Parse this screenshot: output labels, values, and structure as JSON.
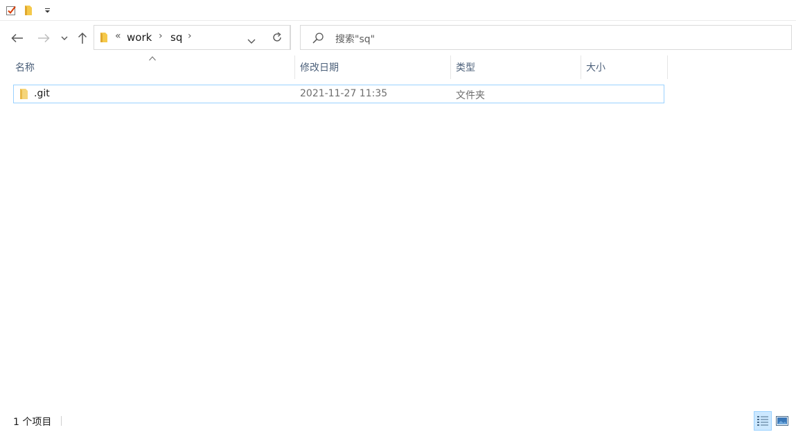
{
  "qat": {
    "icons": [
      "properties-checkmark-icon",
      "folder-icon",
      "customize-dropdown-icon"
    ]
  },
  "nav": {
    "back_icon": "back-arrow-icon",
    "forward_icon": "forward-arrow-icon",
    "recent_icon": "recent-locations-chevron-icon",
    "up_icon": "up-arrow-icon",
    "refresh_icon": "refresh-icon"
  },
  "address": {
    "overflow": "«",
    "crumbs": [
      "work",
      "sq"
    ],
    "separator": "›"
  },
  "search": {
    "placeholder": "搜索\"sq\""
  },
  "columns": {
    "name": "名称",
    "date": "修改日期",
    "type": "类型",
    "size": "大小",
    "sorted_by": "name"
  },
  "rows": [
    {
      "name": ".git",
      "date": "2021-11-27 11:35",
      "type": "文件夹",
      "size": ""
    }
  ],
  "status": {
    "count": "1 个项目"
  },
  "views": {
    "details_icon": "details-view-icon",
    "large_icon": "large-icons-view-icon",
    "active": "details"
  },
  "colors": {
    "header_text": "#4c607a",
    "selection_border": "#99d1ff",
    "selection_fill": "#cce8ff",
    "folder": "#f5c94b"
  }
}
